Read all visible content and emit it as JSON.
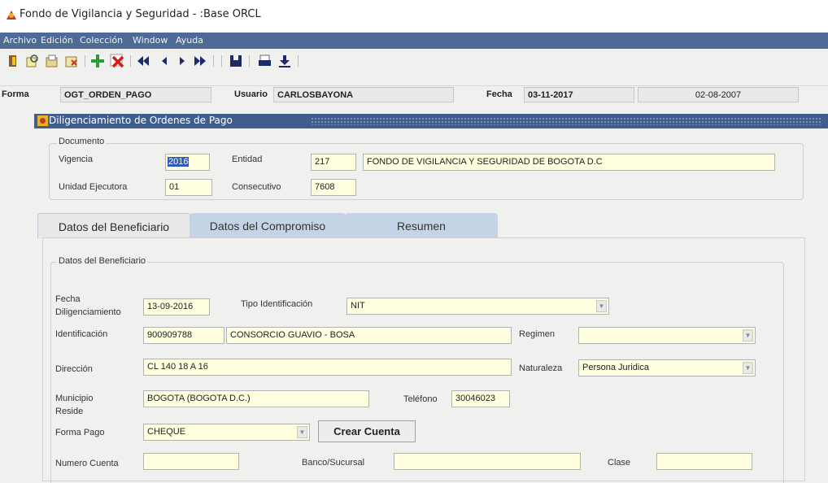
{
  "window": {
    "title": "Fondo de Vigilancia y Seguridad - :Base ORCL"
  },
  "menu": [
    "Archivo",
    "Edición",
    "Colección",
    "Window",
    "Ayuda"
  ],
  "toolbar": {
    "icons": [
      "exit-icon",
      "find-icon",
      "open-icon",
      "clear-icon",
      "insert-record-icon",
      "delete-record-icon",
      "first-record-icon",
      "previous-record-icon",
      "next-record-icon",
      "last-record-icon",
      "save-icon",
      "print-icon",
      "download-icon"
    ]
  },
  "formbar": {
    "forma_label": "Forma",
    "forma_value": "OGT_ORDEN_PAGO",
    "usuario_label": "Usuario",
    "usuario_value": "CARLOSBAYONA",
    "fecha_label": "Fecha",
    "fecha_value": "03-11-2017",
    "version_date": "02-08-2007"
  },
  "form_window": {
    "title": "Diligenciamiento de Ordenes de Pago"
  },
  "documento": {
    "legend": "Documento",
    "vigencia_label": "Vigencia",
    "vigencia_value": "2016",
    "entidad_label": "Entidad",
    "entidad_code": "217",
    "entidad_name": "FONDO DE VIGILANCIA Y SEGURIDAD DE BOGOTA D.C",
    "unidad_label": "Unidad Ejecutora",
    "unidad_value": "01",
    "consecutivo_label": "Consecutivo",
    "consecutivo_value": "7608"
  },
  "tabs": [
    {
      "label": "Datos del Beneficiario",
      "active": true
    },
    {
      "label": "Datos del Compromiso",
      "active": false
    },
    {
      "label": "Resumen",
      "active": false
    }
  ],
  "beneficiario": {
    "legend": "Datos del Beneficiario",
    "fecha_label_1": "Fecha",
    "fecha_label_2": "Diligenciamiento",
    "fecha_value": "13-09-2016",
    "tipo_id_label": "Tipo Identificación",
    "tipo_id_value": "NIT",
    "identificacion_label": "Identificación",
    "identificacion_value": "900909788",
    "identificacion_name": "CONSORCIO GUAVIO - BOSA",
    "regimen_label": "Regimen",
    "regimen_value": "",
    "direccion_label": "Dirección",
    "direccion_value": "CL 140 18 A 16",
    "naturaleza_label": "Naturaleza",
    "naturaleza_value": "Persona Juridica",
    "municipio_label_1": "Municipio",
    "municipio_label_2": "Reside",
    "municipio_value": "BOGOTA  (BOGOTA D.C.)",
    "telefono_label": "Teléfono",
    "telefono_value": "30046023",
    "forma_pago_label": "Forma Pago",
    "forma_pago_value": "CHEQUE",
    "crear_cuenta_label": "Crear Cuenta",
    "numero_cuenta_label": "Numero Cuenta",
    "numero_cuenta_value": "",
    "banco_label": "Banco/Sucursal",
    "banco_value": "",
    "clase_label": "Clase",
    "clase_value": ""
  },
  "colors": {
    "menubar": "#4d6b94",
    "window_title": "#3f5e8d",
    "field_bg": "#ffffe0",
    "active_tab": "#e9e9e9",
    "inactive_tab": "#c5d3e6"
  }
}
